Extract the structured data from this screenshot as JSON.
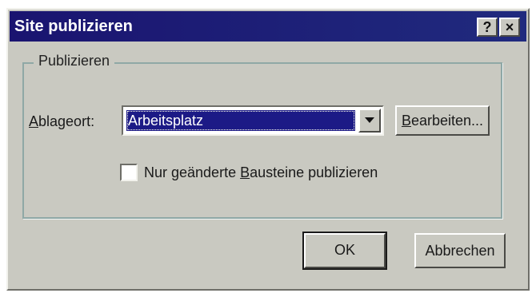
{
  "window": {
    "title": "Site publizieren",
    "help_button": "?",
    "close_button": "×"
  },
  "group": {
    "legend": "Publizieren"
  },
  "location": {
    "label_accel": "A",
    "label_rest": "blageort:",
    "selected_value": "Arbeitsplatz",
    "edit_button_accel": "B",
    "edit_button_rest": "earbeiten..."
  },
  "option": {
    "checked": false,
    "label_before": "Nur geänderte ",
    "label_accel": "B",
    "label_after": "austeine publizieren"
  },
  "footer": {
    "ok_label": "OK",
    "cancel_label": "Abbrechen"
  },
  "colors": {
    "titlebar": "#1a1470",
    "dialog_face": "#c9c9c1",
    "selection": "#1c1a86"
  }
}
